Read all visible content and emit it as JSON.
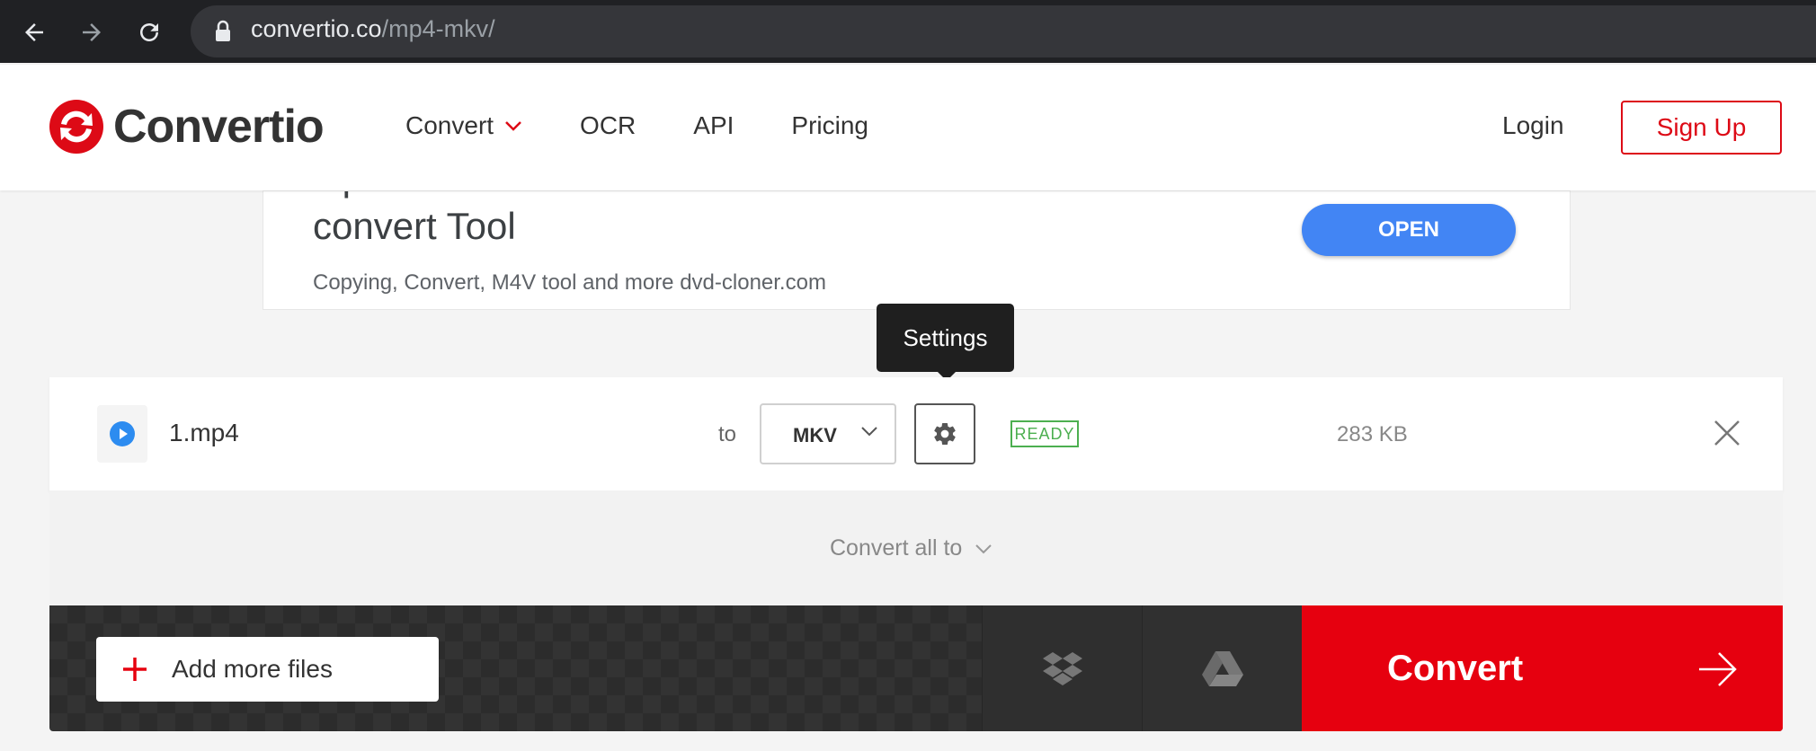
{
  "browser": {
    "url_domain": "convertio.co",
    "url_path": "/mp4-mkv/",
    "icons": [
      "back-arrow-icon",
      "forward-arrow-icon",
      "reload-icon",
      "lock-icon"
    ]
  },
  "header": {
    "logo_text": "Convertio",
    "nav": [
      {
        "label": "Convert",
        "has_dropdown": true
      },
      {
        "label": "OCR"
      },
      {
        "label": "API"
      },
      {
        "label": "Pricing"
      }
    ],
    "login_label": "Login",
    "signup_label": "Sign Up",
    "brand_color": "#dd0a16"
  },
  "ad": {
    "title": "OpenCloner Newest Video Tool - All in One Video convert Tool",
    "subtitle": "Copying, Convert, M4V tool and more dvd-cloner.com",
    "button_label": "OPEN",
    "button_color": "#4285f4"
  },
  "tooltip": {
    "text": "Settings"
  },
  "file": {
    "name": "1.mp4",
    "to_label": "to",
    "target_format": "MKV",
    "status": "READY",
    "size": "283 KB",
    "icons": [
      "play-icon",
      "gear-icon",
      "close-icon"
    ]
  },
  "convert_all": {
    "label": "Convert all to"
  },
  "actions": {
    "add_files_label": "Add more files",
    "convert_label": "Convert",
    "convert_color": "#e6000f",
    "icons": [
      "plus-icon",
      "dropbox-icon",
      "google-drive-icon",
      "arrow-right-icon"
    ]
  }
}
